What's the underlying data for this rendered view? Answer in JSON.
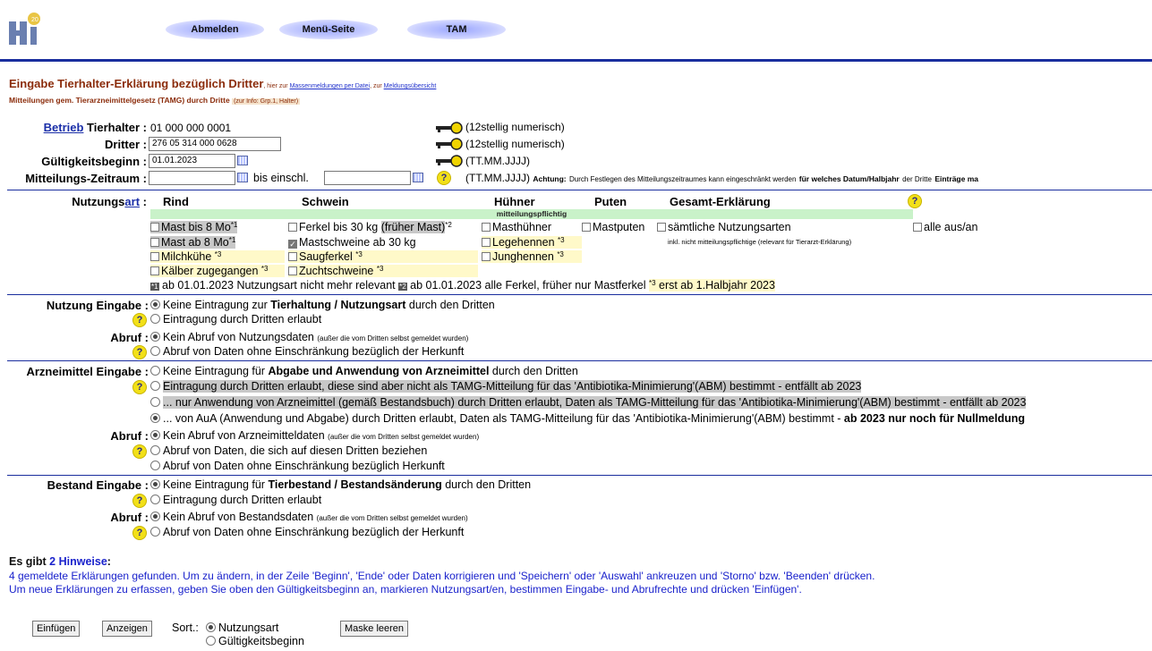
{
  "header": {
    "logo_text": "HI",
    "nav": [
      "Abmelden",
      "Menü-Seite",
      "TAM"
    ]
  },
  "title": {
    "main": "Eingabe Tierhalter-Erklärung bezüglich Dritter",
    "small_a": ", hier zur ",
    "link_mass": "Massenmeldungen per Datei",
    "small_b": ", zur ",
    "link_overview": "Meldungsübersicht",
    "subtitle": "Mitteilungen gem. Tierarzneimittelgesetz (TAMG) durch Dritte",
    "subtitle_tag": "(zur Info: Grp.1, Halter)"
  },
  "form": {
    "betrieb_link": "Betrieb",
    "tierhalter_label": "Tierhalter :",
    "tierhalter_value": "01 000 000 0001",
    "dritter_label": "Dritter :",
    "dritter_value": "276 05 314 000 0628",
    "gueltig_label": "Gültigkeitsbeginn :",
    "gueltig_value": "01.01.2023",
    "zeitraum_label": "Mitteilungs-Zeitraum :",
    "zeitraum_from": "",
    "bis_label": "bis einschl.",
    "zeitraum_to": "",
    "hint_12": "(12stellig numerisch)",
    "hint_date": "(TT.MM.JJJJ)",
    "hint_achtung_label": "Achtung:",
    "hint_achtung_text": "Durch Festlegen des Mitteilungszeitraumes kann eingeschränkt werden",
    "hint_achtung_bold": "für welches Datum/Halbjahr",
    "hint_achtung_tail": "der Dritte",
    "hint_achtung_bold2": "Einträge ma"
  },
  "nutzung": {
    "label_a": "Nutzungs",
    "label_link": "art",
    "label_colon": " :",
    "columns": [
      "Rind",
      "Schwein",
      "Hühner",
      "Puten",
      "Gesamt-Erklärung"
    ],
    "pflichtig": "mitteilungspflichtig",
    "rind": [
      {
        "label": "Mast bis 8 Mo",
        "sup": "*1",
        "checked": false
      },
      {
        "label": "Mast ab 8 Mo",
        "sup": "*1",
        "checked": false
      },
      {
        "label": "Milchkühe",
        "sup": "*3",
        "checked": false
      },
      {
        "label": "Kälber zugegangen",
        "sup": "*3",
        "checked": false
      }
    ],
    "schwein": [
      {
        "label": "Ferkel bis 30 kg",
        "extra": "(früher Mast)",
        "sup": "*2",
        "checked": false
      },
      {
        "label": "Mastschweine ab 30 kg",
        "checked": true
      },
      {
        "label": "Saugferkel",
        "sup": "*3",
        "checked": false
      },
      {
        "label": "Zuchtschweine",
        "sup": "*3",
        "checked": false
      }
    ],
    "huehner": [
      {
        "label": "Masthühner",
        "checked": false
      },
      {
        "label": "Legehennen",
        "sup": "*3",
        "checked": false
      },
      {
        "label": "Junghennen",
        "sup": "*3",
        "checked": false
      }
    ],
    "puten": [
      {
        "label": "Mastputen",
        "checked": false
      }
    ],
    "gesamt": {
      "label": "sämtliche Nutzungsarten",
      "note": "inkl. nicht mitteilungspflichtige (relevant für Tierarzt-Erklärung)",
      "checked": false
    },
    "alle": "alle aus/an",
    "footnote": {
      "m1": "*1",
      "t1": " ab 01.01.2023 Nutzungsart nicht mehr relevant ",
      "m2": "*2",
      "t2": " ab 01.01.2023 alle Ferkel, früher nur Mastferkel ",
      "m3": "*3",
      "t3": " erst ab 1.Halbjahr 2023"
    }
  },
  "sections": {
    "nutzung_eingabe": "Nutzung Eingabe :",
    "ne_opt1_a": "Keine Eintragung zur ",
    "ne_opt1_b": "Tierhaltung / Nutzungsart",
    "ne_opt1_c": " durch den Dritten",
    "ne_opt2": "Eintragung durch Dritten erlaubt",
    "abruf": "Abruf :",
    "na_opt1": "Kein Abruf von Nutzungsdaten",
    "na_opt1_small": "(außer die vom Dritten selbst gemeldet wurden)",
    "na_opt2": "Abruf von Daten ohne Einschränkung bezüglich der Herkunft",
    "arznei_eingabe": "Arzneimittel Eingabe :",
    "ae_opt1_a": "Keine Eintragung für ",
    "ae_opt1_b": "Abgabe und Anwendung von Arzneimittel",
    "ae_opt1_c": " durch den Dritten",
    "ae_opt2": "Eintragung durch Dritten erlaubt, diese sind aber nicht als TAMG-Mitteilung für das 'Antibiotika-Minimierung'(ABM) bestimmt - entfällt ab 2023",
    "ae_opt3": "... nur Anwendung von Arzneimittel (gemäß Bestandsbuch) durch Dritten erlaubt, Daten als TAMG-Mitteilung für das 'Antibiotika-Minimierung'(ABM) bestimmt - entfällt ab 2023",
    "ae_opt4_a": "... von AuA (Anwendung und Abgabe) durch Dritten erlaubt, Daten als TAMG-Mitteilung für das 'Antibiotika-Minimierung'(ABM) bestimmt - ",
    "ae_opt4_b": "ab 2023 nur noch für Nullmeldung",
    "aa_opt1": "Kein Abruf von Arzneimitteldaten",
    "aa_opt1_small": "(außer die vom Dritten selbst gemeldet wurden)",
    "aa_opt2": "Abruf von Daten, die sich auf diesen Dritten beziehen",
    "aa_opt3": "Abruf von Daten ohne Einschränkung bezüglich Herkunft",
    "bestand_eingabe": "Bestand Eingabe :",
    "be_opt1_a": "Keine Eintragung für ",
    "be_opt1_b": "Tierbestand / Bestandsänderung",
    "be_opt1_c": " durch den Dritten",
    "be_opt2": "Eintragung durch Dritten erlaubt",
    "ba_opt1": "Kein Abruf von Bestandsdaten",
    "ba_opt1_small": "(außer die vom Dritten selbst gemeldet wurden)",
    "ba_opt2": "Abruf von Daten ohne Einschränkung bezüglich der Herkunft"
  },
  "hinweise": {
    "head_a": "Es gibt ",
    "count": "2",
    "head_b": " Hinweise",
    "head_colon": ":",
    "line1": "4 gemeldete Erklärungen gefunden. Um zu ändern, in der Zeile 'Beginn', 'Ende' oder Daten korrigieren und 'Speichern' oder 'Auswahl' ankreuzen und 'Storno' bzw. 'Beenden' drücken.",
    "line2": "Um neue Erklärungen zu erfassen, geben Sie oben den Gültigkeitsbeginn an, markieren Nutzungsart/en, bestimmen Eingabe- und Abrufrechte und drücken 'Einfügen'."
  },
  "actions": {
    "einfuegen": "Einfügen",
    "anzeigen": "Anzeigen",
    "sort_label": "Sort.:",
    "sort_opt1": "Nutzungsart",
    "sort_opt2": "Gültigkeitsbeginn",
    "maske": "Maske leeren"
  },
  "colors": {
    "accent_blue": "#1a2e9e",
    "title_brown": "#8b2c0b",
    "link_blue": "#1a22cc",
    "pflichtig_green": "#c9f2c9",
    "note_yellow": "#fff9c9"
  }
}
